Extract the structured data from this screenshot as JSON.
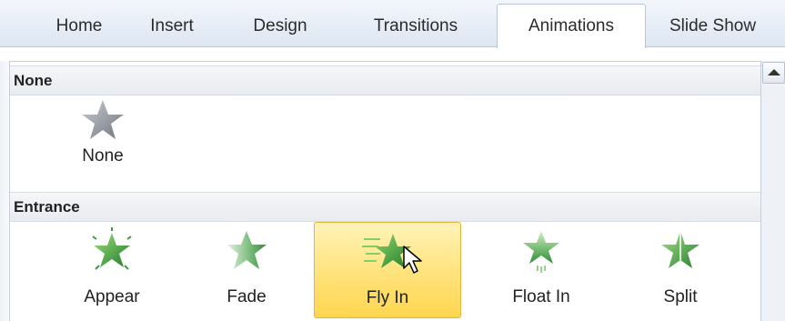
{
  "ribbon": {
    "tabs": [
      {
        "label": "Home"
      },
      {
        "label": "Insert"
      },
      {
        "label": "Design"
      },
      {
        "label": "Transitions"
      },
      {
        "label": "Animations",
        "active": true
      },
      {
        "label": "Slide Show"
      }
    ]
  },
  "gallery": {
    "sections": [
      {
        "title": "None",
        "items": [
          {
            "label": "None",
            "icon": "star-none-icon"
          }
        ]
      },
      {
        "title": "Entrance",
        "items": [
          {
            "label": "Appear",
            "icon": "star-appear-icon"
          },
          {
            "label": "Fade",
            "icon": "star-fade-icon"
          },
          {
            "label": "Fly In",
            "icon": "star-fly-in-icon",
            "selected": true
          },
          {
            "label": "Float In",
            "icon": "star-float-in-icon"
          },
          {
            "label": "Split",
            "icon": "star-split-icon"
          }
        ]
      }
    ]
  },
  "colors": {
    "entrance_green": "#3f9b3f",
    "none_gray": "#8a8f98",
    "selection": "#ffe27a"
  },
  "cursor": {
    "icon": "mouse-pointer-icon"
  }
}
